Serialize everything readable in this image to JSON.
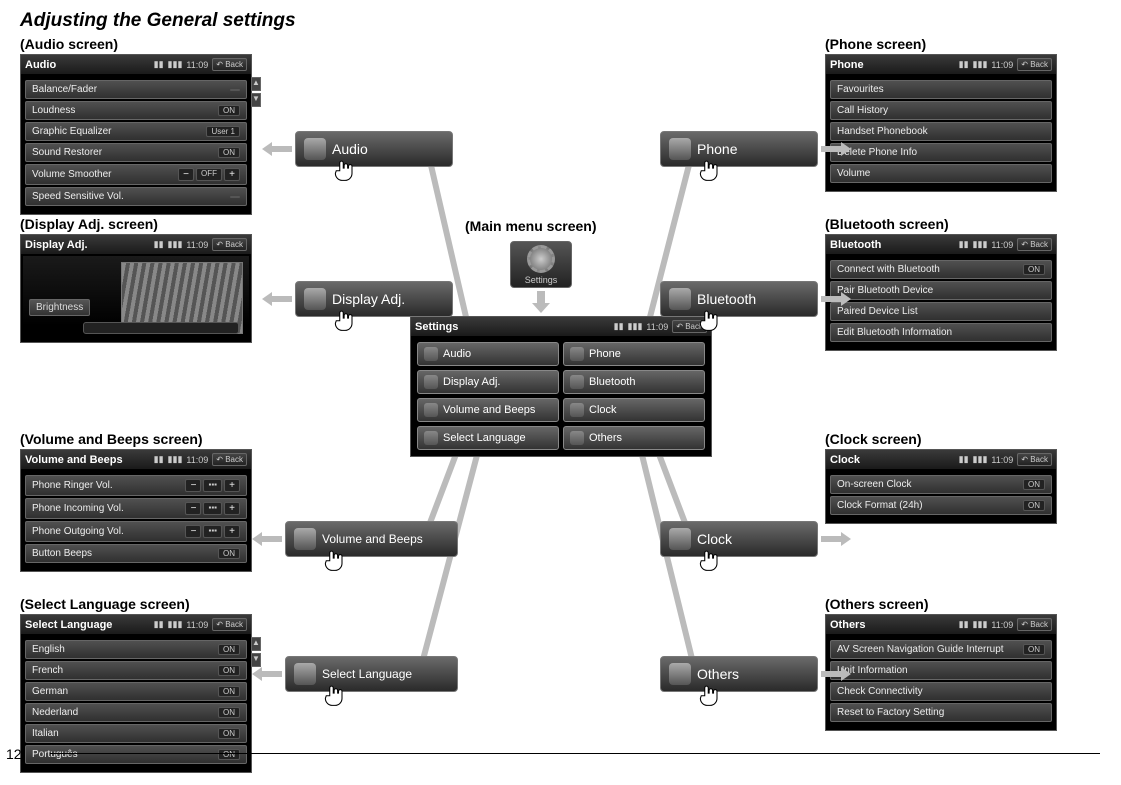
{
  "page_title": "Adjusting the General settings",
  "page_number": "12",
  "clock": "11:09",
  "back_label": "Back",
  "main_menu_caption": "(Main menu screen)",
  "settings_label": "Settings",
  "central": {
    "title": "Settings",
    "buttons": [
      {
        "label": "Audio"
      },
      {
        "label": "Phone"
      },
      {
        "label": "Display Adj."
      },
      {
        "label": "Bluetooth"
      },
      {
        "label": "Volume and Beeps"
      },
      {
        "label": "Clock"
      },
      {
        "label": "Select Language"
      },
      {
        "label": "Others"
      }
    ]
  },
  "bigbuttons": {
    "audio": "Audio",
    "phone": "Phone",
    "display": "Display Adj.",
    "bluetooth": "Bluetooth",
    "volbeeps": "Volume and Beeps",
    "clock": "Clock",
    "lang": "Select Language",
    "others": "Others"
  },
  "screens": {
    "audio": {
      "caption": "(Audio screen)",
      "title": "Audio",
      "rows": [
        {
          "label": "Balance/Fader",
          "right": ""
        },
        {
          "label": "Loudness",
          "right": "ON"
        },
        {
          "label": "Graphic Equalizer",
          "right": "User 1"
        },
        {
          "label": "Sound Restorer",
          "right": "ON"
        },
        {
          "label": "Volume Smoother",
          "right": "OFF"
        },
        {
          "label": "Speed Sensitive Vol.",
          "right": ""
        }
      ]
    },
    "display": {
      "caption": "(Display Adj. screen)",
      "title": "Display Adj.",
      "brightness_label": "Brightness"
    },
    "volbeeps": {
      "caption": "(Volume and Beeps screen)",
      "title": "Volume and Beeps",
      "rows": [
        {
          "label": "Phone Ringer Vol."
        },
        {
          "label": "Phone Incoming Vol."
        },
        {
          "label": "Phone Outgoing Vol."
        },
        {
          "label": "Button Beeps",
          "right": "ON"
        }
      ]
    },
    "lang": {
      "caption": "(Select Language screen)",
      "title": "Select Language",
      "rows": [
        {
          "label": "English",
          "right": "ON"
        },
        {
          "label": "French",
          "right": "ON"
        },
        {
          "label": "German",
          "right": "ON"
        },
        {
          "label": "Nederland",
          "right": "ON"
        },
        {
          "label": "Italian",
          "right": "ON"
        },
        {
          "label": "Português",
          "right": "ON"
        }
      ]
    },
    "phone": {
      "caption": "(Phone screen)",
      "title": "Phone",
      "rows": [
        {
          "label": "Favourites"
        },
        {
          "label": "Call History"
        },
        {
          "label": "Handset Phonebook"
        },
        {
          "label": "Delete Phone Info"
        },
        {
          "label": "Volume"
        }
      ]
    },
    "bluetooth": {
      "caption": "(Bluetooth screen)",
      "title": "Bluetooth",
      "rows": [
        {
          "label": "Connect with Bluetooth",
          "right": "ON"
        },
        {
          "label": "Pair Bluetooth Device"
        },
        {
          "label": "Paired Device List"
        },
        {
          "label": "Edit Bluetooth Information"
        }
      ]
    },
    "clockscr": {
      "caption": "(Clock screen)",
      "title": "Clock",
      "rows": [
        {
          "label": "On-screen Clock",
          "right": "ON"
        },
        {
          "label": "Clock Format (24h)",
          "right": "ON"
        }
      ]
    },
    "others": {
      "caption": "(Others screen)",
      "title": "Others",
      "rows": [
        {
          "label": "AV Screen Navigation Guide Interrupt",
          "right": "ON"
        },
        {
          "label": "Unit Information"
        },
        {
          "label": "Check Connectivity"
        },
        {
          "label": "Reset to Factory Setting"
        }
      ]
    }
  }
}
